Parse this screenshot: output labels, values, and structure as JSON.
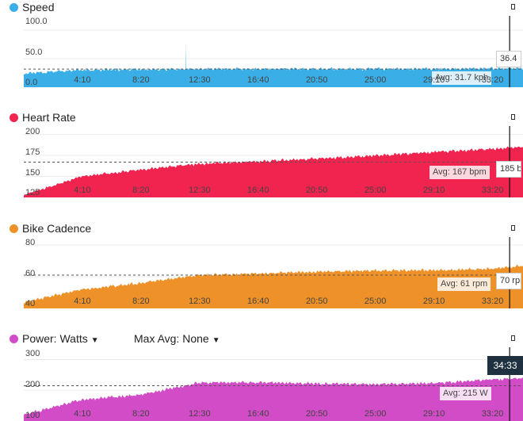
{
  "x_ticks": [
    "4:10",
    "8:20",
    "12:30",
    "16:40",
    "20:50",
    "25:00",
    "29:10",
    "33:20"
  ],
  "cursor_time": "34:33",
  "panels": [
    {
      "id": "speed",
      "title": "Speed",
      "color": "#3aaee6",
      "y_ticks": [
        "100.0",
        "50.0",
        "0.0"
      ],
      "y_range": [
        0,
        125
      ],
      "avg_value": 31.7,
      "avg_label": "Avg: 31.7 kph",
      "cursor_label": "36.4",
      "chart_data": {
        "type": "area",
        "x": [
          "0:00",
          "4:10",
          "8:20",
          "12:30",
          "16:40",
          "20:50",
          "25:00",
          "29:10",
          "33:20",
          "35:30"
        ],
        "values": [
          24,
          30,
          31,
          32,
          32,
          32,
          32,
          32,
          33,
          33
        ],
        "spikes": [
          {
            "x": "11:30",
            "value": 80
          }
        ],
        "avg": 31.7,
        "ylim": [
          0,
          125
        ]
      }
    },
    {
      "id": "heart",
      "title": "Heart Rate",
      "color": "#f0244f",
      "y_ticks": [
        "200",
        "175",
        "150",
        "125"
      ],
      "y_range": [
        125,
        210
      ],
      "avg_value": 167,
      "avg_label": "Avg: 167 bpm",
      "cursor_label": "185 bpm",
      "chart_data": {
        "type": "area",
        "x": [
          "0:00",
          "4:10",
          "8:20",
          "12:30",
          "16:40",
          "20:50",
          "25:00",
          "29:10",
          "33:20",
          "35:30"
        ],
        "values": [
          128,
          150,
          158,
          165,
          168,
          171,
          175,
          179,
          183,
          185
        ],
        "avg": 167,
        "ylim": [
          125,
          210
        ]
      }
    },
    {
      "id": "cadence",
      "title": "Bike Cadence",
      "color": "#ee9128",
      "y_ticks": [
        "80",
        "60",
        "40"
      ],
      "y_range": [
        40,
        85
      ],
      "avg_value": 61,
      "avg_label": "Avg: 61 rpm",
      "cursor_label": "70 rpm",
      "chart_data": {
        "type": "area",
        "x": [
          "0:00",
          "4:10",
          "8:20",
          "12:30",
          "16:40",
          "20:50",
          "25:00",
          "29:10",
          "33:20",
          "35:30"
        ],
        "values": [
          44,
          52,
          56,
          61,
          62,
          63,
          64,
          64,
          65,
          67
        ],
        "avg": 61,
        "ylim": [
          40,
          85
        ]
      }
    },
    {
      "id": "power",
      "title": "Power: Watts",
      "color": "#d14cc6",
      "max_avg_label": "Max Avg: None",
      "y_ticks": [
        "300",
        "200",
        "100"
      ],
      "y_range": [
        100,
        340
      ],
      "avg_value": 215,
      "avg_label": "Avg: 215 W",
      "chart_data": {
        "type": "area",
        "x": [
          "0:00",
          "4:10",
          "8:20",
          "12:30",
          "16:40",
          "20:50",
          "25:00",
          "29:10",
          "33:20",
          "35:30"
        ],
        "values": [
          120,
          170,
          185,
          225,
          225,
          222,
          220,
          223,
          235,
          240
        ],
        "avg": 215,
        "ylim": [
          100,
          340
        ]
      }
    }
  ]
}
